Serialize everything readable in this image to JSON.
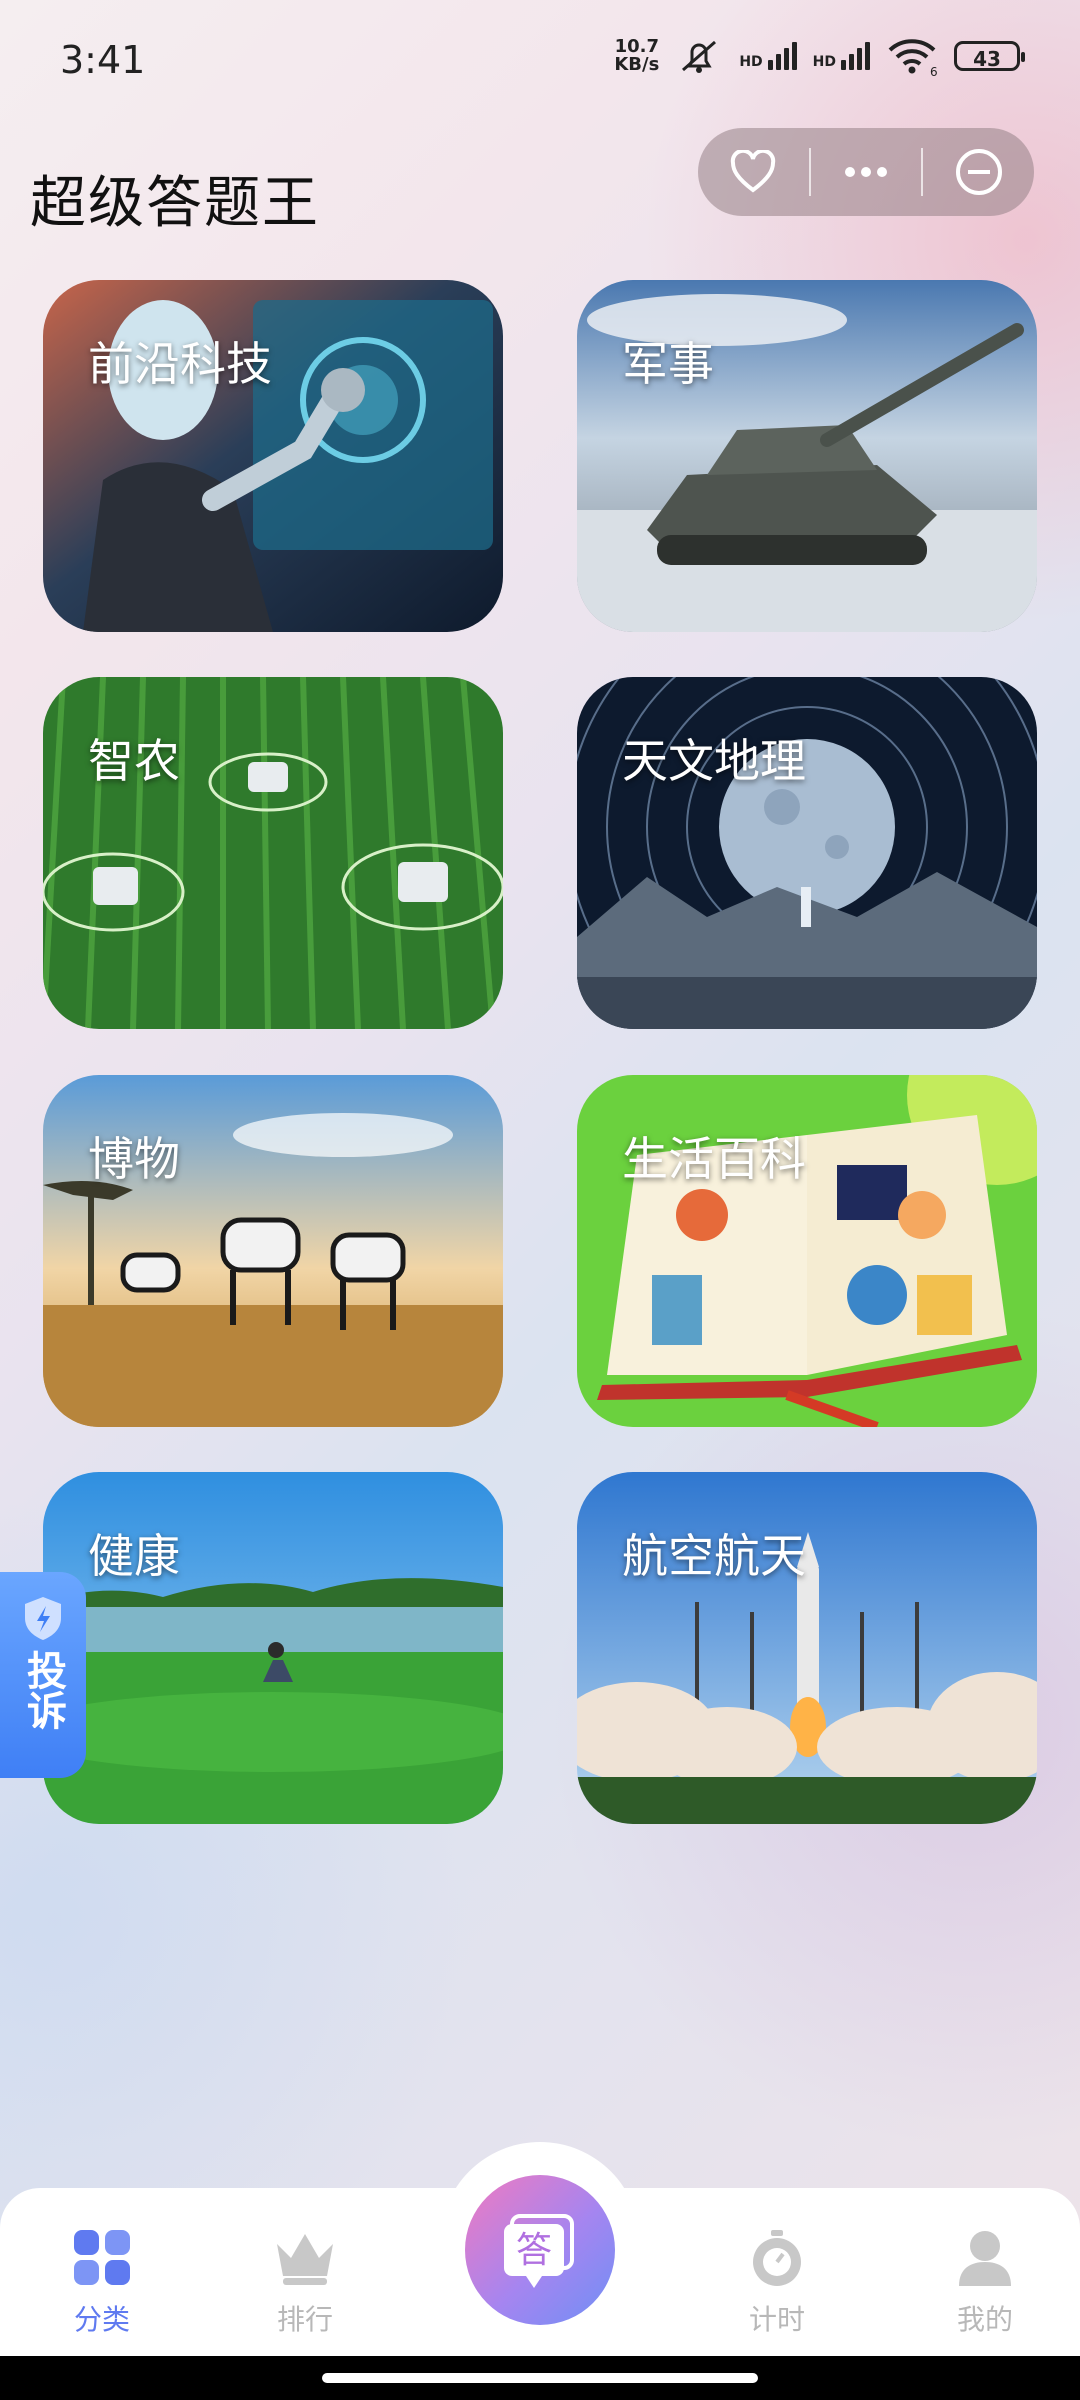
{
  "status_bar": {
    "time": "3:41",
    "net_speed_value": "10.7",
    "net_speed_unit": "KB/s",
    "hd1": "HD",
    "hd2": "HD",
    "wifi_tag": "6",
    "battery": "43"
  },
  "header": {
    "title": "超级答题王"
  },
  "capsule": {
    "icons": [
      "heart-icon",
      "more-icon",
      "minimize-icon"
    ]
  },
  "categories": [
    {
      "label": "前沿科技"
    },
    {
      "label": "军事"
    },
    {
      "label": "智农"
    },
    {
      "label": "天文地理"
    },
    {
      "label": "博物"
    },
    {
      "label": "生活百科"
    },
    {
      "label": "健康"
    },
    {
      "label": "航空航天"
    }
  ],
  "complaint": {
    "label": "投诉"
  },
  "bottom_nav": {
    "items": [
      {
        "label": "分类",
        "active": true
      },
      {
        "label": "排行"
      },
      {
        "label": "计时"
      },
      {
        "label": "我的"
      }
    ],
    "center_label": "答"
  },
  "colors": {
    "accent": "#5f7af0",
    "inactive": "#b8b8b8"
  }
}
